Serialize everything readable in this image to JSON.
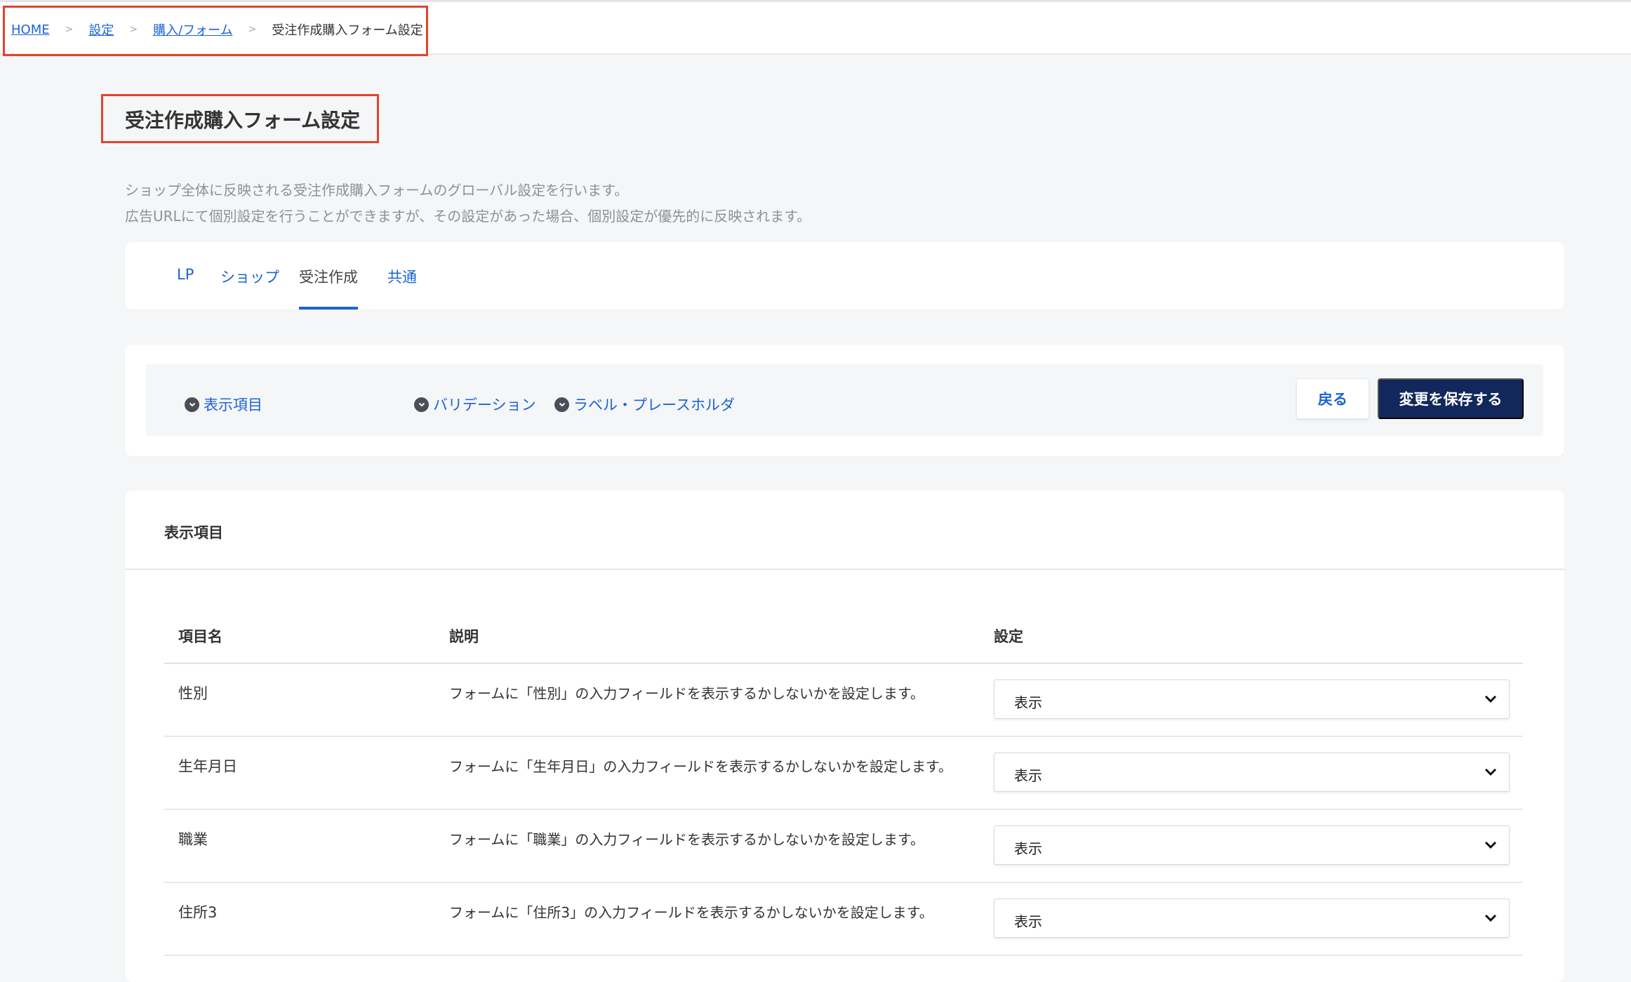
{
  "breadcrumb": {
    "home": "HOME",
    "settings": "設定",
    "purchase_form": "購入/フォーム",
    "current": "受注作成購入フォーム設定",
    "separator": ">"
  },
  "page": {
    "title": "受注作成購入フォーム設定",
    "description_line1": "ショップ全体に反映される受注作成購入フォームのグローバル設定を行います。",
    "description_line2": "広告URLにて個別設定を行うことができますが、その設定があった場合、個別設定が優先的に反映されます。"
  },
  "tabs": [
    {
      "label": "LP",
      "active": false
    },
    {
      "label": "ショップ",
      "active": false
    },
    {
      "label": "受注作成",
      "active": true
    },
    {
      "label": "共通",
      "active": false
    }
  ],
  "anchors": [
    {
      "label": "表示項目"
    },
    {
      "label": "バリデーション"
    },
    {
      "label": "ラベル・プレースホルダ"
    }
  ],
  "actions": {
    "back_label": "戻る",
    "save_label": "変更を保存する"
  },
  "section": {
    "title": "表示項目",
    "columns": {
      "name": "項目名",
      "description": "説明",
      "setting": "設定"
    },
    "rows": [
      {
        "name": "性別",
        "description": "フォームに「性別」の入力フィールドを表示するかしないかを設定します。",
        "value": "表示"
      },
      {
        "name": "生年月日",
        "description": "フォームに「生年月日」の入力フィールドを表示するかしないかを設定します。",
        "value": "表示"
      },
      {
        "name": "職業",
        "description": "フォームに「職業」の入力フィールドを表示するかしないかを設定します。",
        "value": "表示"
      },
      {
        "name": "住所3",
        "description": "フォームに「住所3」の入力フィールドを表示するかしないかを設定します。",
        "value": "表示"
      }
    ]
  },
  "colors": {
    "link": "#1a63d6",
    "primary_button": "#12275c",
    "highlight": "#e0442c",
    "background": "#f5f6f8"
  }
}
